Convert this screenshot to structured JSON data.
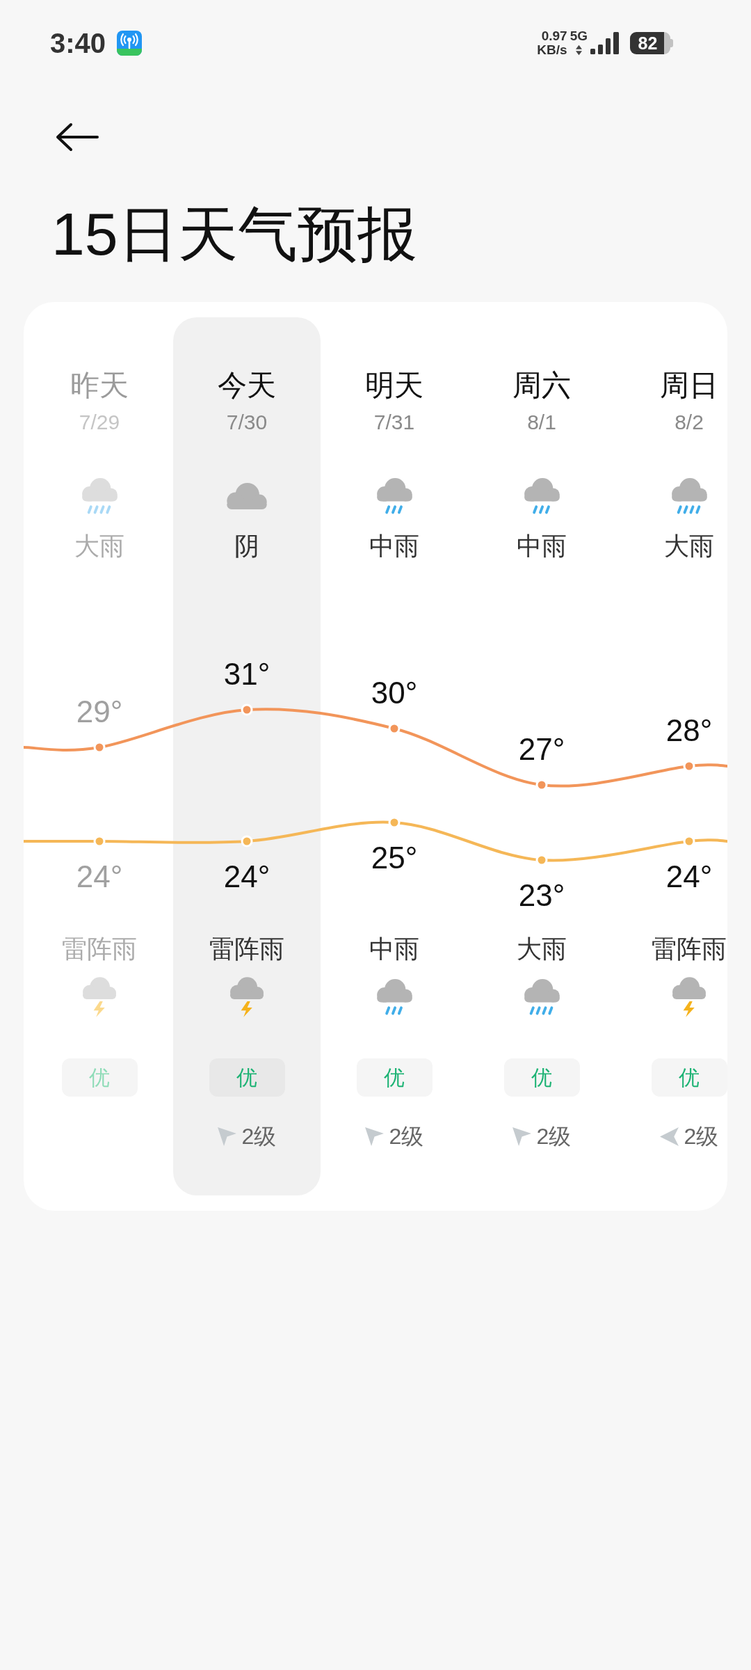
{
  "status_bar": {
    "time": "3:40",
    "net_speed": "0.97",
    "net_speed_unit": "KB/s",
    "network": "5G",
    "battery": "82"
  },
  "header": {
    "title": "15日天气预报"
  },
  "forecast": {
    "days": [
      {
        "name": "昨天",
        "date": "7/29",
        "past": true,
        "selected": false,
        "day": {
          "kind": "heavy_rain",
          "text": "大雨"
        },
        "night": {
          "kind": "thunderstorm",
          "text": "雷阵雨"
        },
        "aqi": "优"
      },
      {
        "name": "今天",
        "date": "7/30",
        "past": false,
        "selected": true,
        "day": {
          "kind": "overcast",
          "text": "阴"
        },
        "night": {
          "kind": "thunderstorm",
          "text": "雷阵雨"
        },
        "aqi": "优",
        "wind": {
          "kind": "arrow_up_left",
          "text": "2级"
        }
      },
      {
        "name": "明天",
        "date": "7/31",
        "past": false,
        "selected": false,
        "day": {
          "kind": "moderate_rain",
          "text": "中雨"
        },
        "night": {
          "kind": "moderate_rain",
          "text": "中雨"
        },
        "aqi": "优",
        "wind": {
          "kind": "arrow_up_left",
          "text": "2级"
        }
      },
      {
        "name": "周六",
        "date": "8/1",
        "past": false,
        "selected": false,
        "day": {
          "kind": "moderate_rain",
          "text": "中雨"
        },
        "night": {
          "kind": "heavy_rain",
          "text": "大雨"
        },
        "aqi": "优",
        "wind": {
          "kind": "arrow_up_left",
          "text": "2级"
        }
      },
      {
        "name": "周日",
        "date": "8/2",
        "past": false,
        "selected": false,
        "day": {
          "kind": "heavy_rain",
          "text": "大雨"
        },
        "night": {
          "kind": "thunderstorm",
          "text": "雷阵雨"
        },
        "aqi": "优",
        "wind": {
          "kind": "arrow_left",
          "text": "2级"
        }
      }
    ],
    "chart_data": {
      "type": "line",
      "series": [
        {
          "color": "#f2955a",
          "marker": "o",
          "values": [
            29,
            31,
            30,
            27,
            28
          ],
          "value_labels": [
            "29°",
            "31°",
            "30°",
            "27°",
            "28°"
          ]
        },
        {
          "color": "#f5b757",
          "marker": "o",
          "values": [
            24,
            24,
            25,
            23,
            24
          ],
          "value_labels": [
            "24°",
            "24°",
            "25°",
            "23°",
            "24°"
          ]
        }
      ]
    }
  }
}
